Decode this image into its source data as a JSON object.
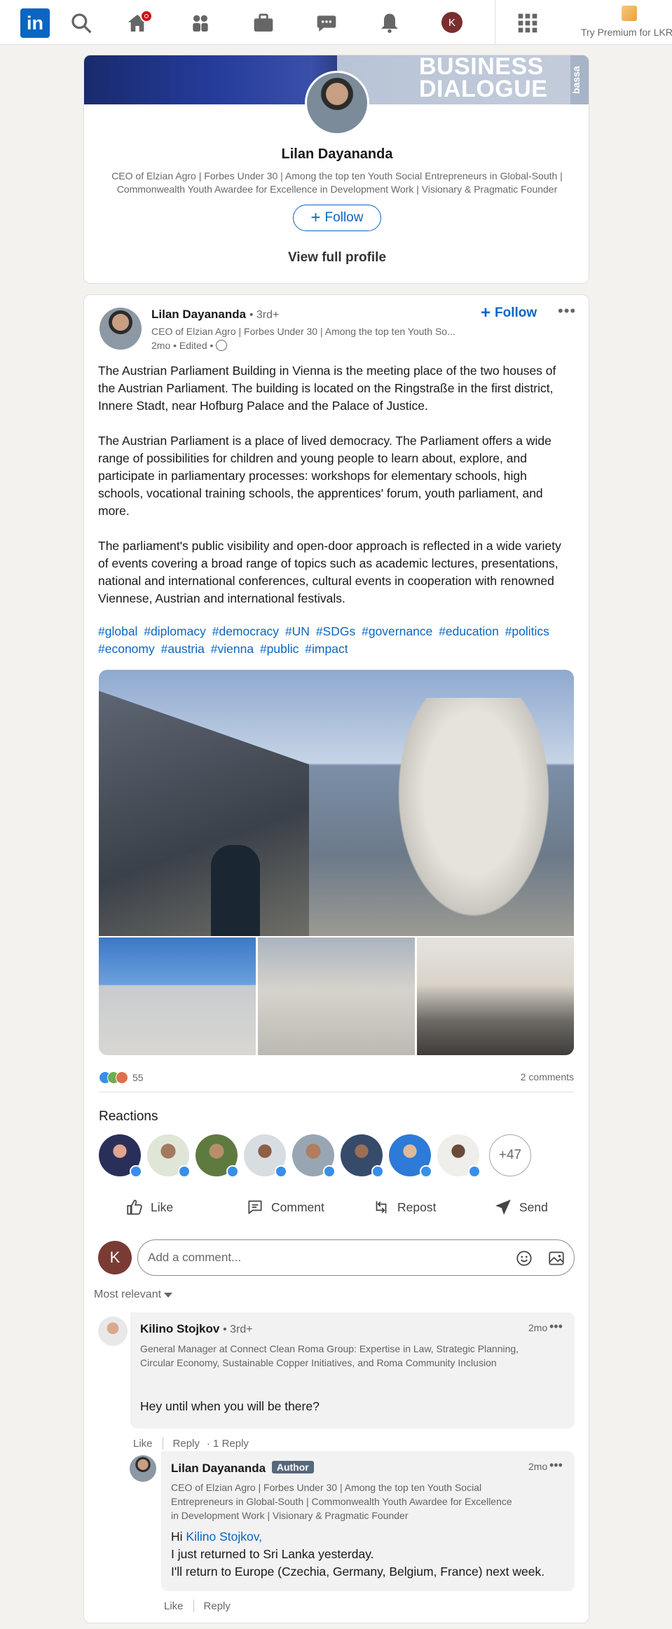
{
  "nav": {
    "logo": "in",
    "premium_text": "Try Premium for LKR",
    "me_initial": "K"
  },
  "profile_card": {
    "cover_text": "BUSINESS\nDIALOGUE",
    "cover_side": "bassa",
    "name": "Lilan Dayananda",
    "headline": "CEO of Elzian Agro | Forbes Under 30 | Among the top ten Youth Social Entrepreneurs in Global-South | Commonwealth Youth Awardee for Excellence in Development Work | Visionary & Pragmatic Founder",
    "follow_label": "Follow",
    "view_profile": "View full profile"
  },
  "post": {
    "author": "Lilan Dayananda",
    "degree": "• 3rd+",
    "author_headline": "CEO of Elzian Agro | Forbes Under 30 | Among the top ten Youth So...",
    "time": "2mo • Edited •",
    "follow_label": "Follow",
    "more": "•••",
    "body": [
      "The Austrian Parliament Building in Vienna is the meeting place of the two houses of the Austrian Parliament. The building is located on the Ringstraße in the first district, Innere Stadt, near Hofburg Palace and the Palace of Justice.",
      "The Austrian Parliament is a place of lived democracy. The Parliament offers a wide range of possibilities for children and young people to learn about, explore, and participate in parliamentary processes: workshops for elementary schools, high schools, vocational training schools, the apprentices' forum, youth parliament, and more.",
      "The parliament's public visibility and open-door approach is reflected in a wide variety of events covering a broad range of topics such as academic lectures, presentations, national and international conferences, cultural events in cooperation with renowned Viennese, Austrian and international festivals."
    ],
    "hashtags": [
      "#global",
      "#diplomacy",
      "#democracy",
      "#UN",
      "#SDGs",
      "#governance",
      "#education",
      "#politics",
      "#economy",
      "#austria",
      "#vienna",
      "#public",
      "#impact"
    ],
    "reaction_count": "55",
    "comments_count": "2 comments",
    "reactions_title": "Reactions",
    "more_reactors": "+47",
    "actions": [
      "Like",
      "Comment",
      "Repost",
      "Send"
    ],
    "comment_placeholder": "Add a comment...",
    "sort_label": "Most relevant"
  },
  "comments": [
    {
      "name": "Kilino Stojkov",
      "degree": "• 3rd+",
      "headline": "General Manager at Connect Clean Roma Group: Expertise in Law, Strategic Planning, Circular Economy, Sustainable Copper Initiatives, and Roma Community Inclusion",
      "text": "Hey until when you will be there?",
      "time": "2mo",
      "like": "Like",
      "reply": "Reply",
      "replies": "· 1 Reply"
    },
    {
      "name": "Lilan Dayananda",
      "badge": "Author",
      "headline": "CEO of Elzian Agro | Forbes Under 30 | Among the top ten Youth Social Entrepreneurs in Global-South | Commonwealth Youth Awardee for Excellence in Development Work | Visionary & Pragmatic Founder",
      "greeting": "Hi",
      "mention": "Kilino Stojkov,",
      "line2": "I just returned to Sri Lanka yesterday.",
      "line3": "I'll return to Europe (Czechia, Germany, Belgium, France) next week.",
      "time": "2mo",
      "like": "Like",
      "reply": "Reply"
    }
  ],
  "colors": {
    "brand": "#0a66c2",
    "background": "#f3f2ef",
    "notification": "#cc1016"
  }
}
